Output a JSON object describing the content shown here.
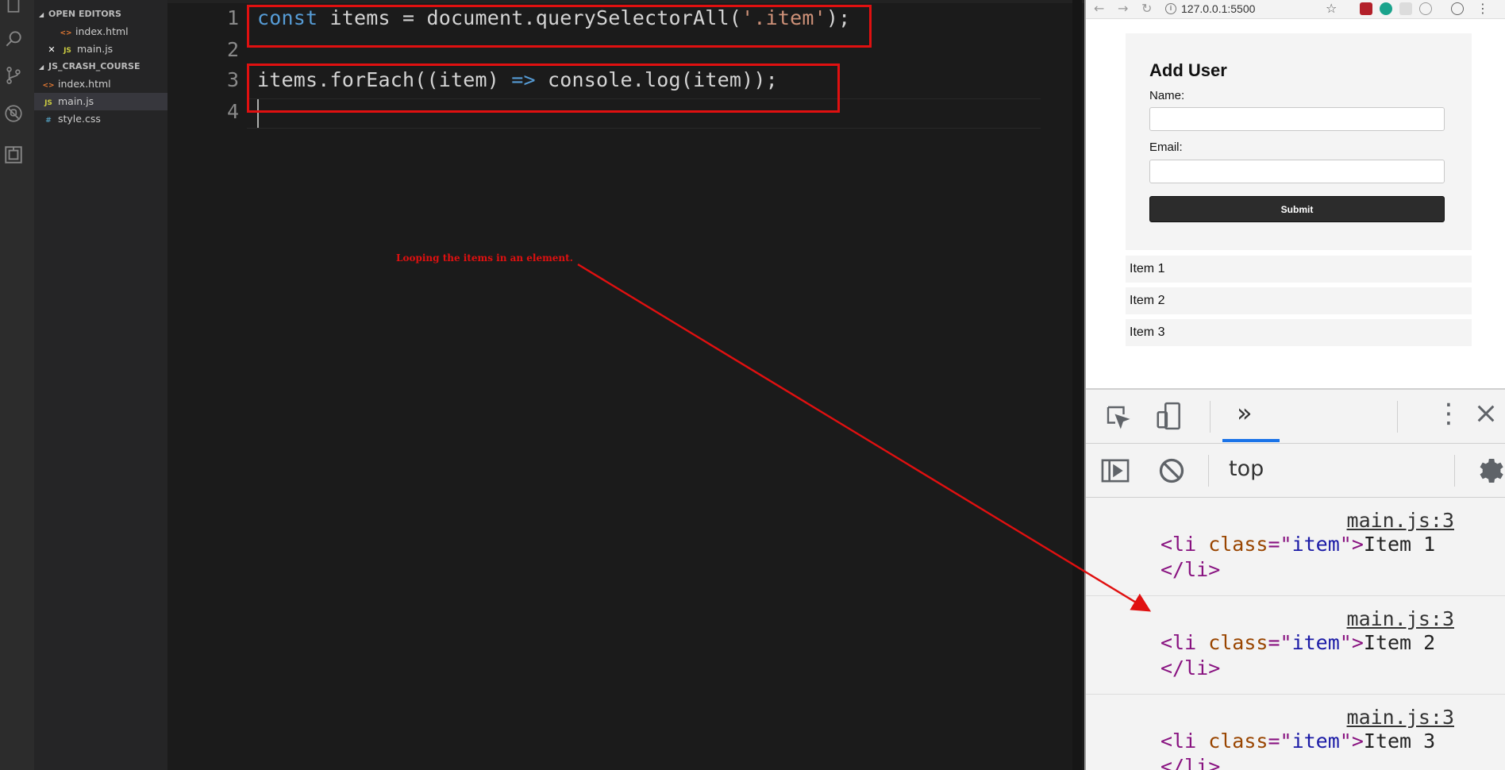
{
  "sidebar": {
    "open_editors_header": "OPEN EDITORS",
    "open_editors": [
      {
        "label": "index.html",
        "icon": "html-file-icon"
      },
      {
        "label": "main.js",
        "icon": "js-file-icon"
      }
    ],
    "project_header": "JS_CRASH_COURSE",
    "files": [
      {
        "label": "index.html",
        "icon": "html-file-icon"
      },
      {
        "label": "main.js",
        "icon": "js-file-icon"
      },
      {
        "label": "style.css",
        "icon": "css-file-icon"
      }
    ]
  },
  "editor": {
    "line_numbers": [
      "1",
      "2",
      "3",
      "4"
    ],
    "line1": {
      "kw": "const",
      "mid": " items = document.querySelectorAll(",
      "str": "'.item'",
      "end": ");"
    },
    "line3": {
      "start": "items.forEach((item) ",
      "arrow": "=>",
      "end": " console.log(item));"
    },
    "annotation": "Looping the items in an element."
  },
  "browser": {
    "url": "127.0.0.1:5500",
    "form": {
      "title": "Add User",
      "name_label": "Name:",
      "email_label": "Email:",
      "name_value": "",
      "email_value": "",
      "submit_label": "Submit"
    },
    "items": [
      "Item 1",
      "Item 2",
      "Item 3"
    ]
  },
  "devtools": {
    "more_tabs_label": "»",
    "context": "top",
    "logs": [
      {
        "source": "main.js:3",
        "tag_open": "<li",
        "attr": " class",
        "eq": "=\"",
        "val": "item",
        "close_q": "\">",
        "text": "Item 1",
        "tag_close": "</li>"
      },
      {
        "source": "main.js:3",
        "tag_open": "<li",
        "attr": " class",
        "eq": "=\"",
        "val": "item",
        "close_q": "\">",
        "text": "Item 2",
        "tag_close": "</li>"
      },
      {
        "source": "main.js:3",
        "tag_open": "<li",
        "attr": " class",
        "eq": "=\"",
        "val": "item",
        "close_q": "\">",
        "text": "Item 3",
        "tag_close": "</li>"
      }
    ]
  },
  "colors": {
    "highlight_box": "#e01010",
    "keyword": "#569cd6",
    "string": "#ce9178",
    "devtools_tab_accent": "#1a73e8"
  }
}
